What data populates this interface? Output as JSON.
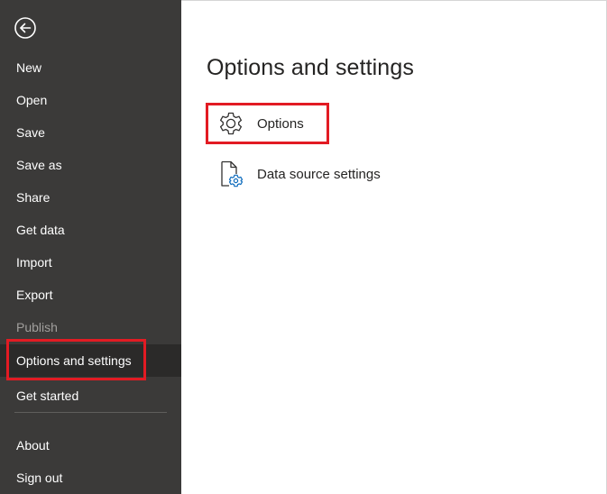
{
  "sidebar": {
    "back_icon": "back-arrow-icon",
    "items": [
      {
        "label": "New"
      },
      {
        "label": "Open"
      },
      {
        "label": "Save"
      },
      {
        "label": "Save as"
      },
      {
        "label": "Share"
      },
      {
        "label": "Get data"
      },
      {
        "label": "Import"
      },
      {
        "label": "Export"
      },
      {
        "label": "Publish",
        "disabled": true
      },
      {
        "label": "Options and settings",
        "selected": true
      },
      {
        "label": "Get started"
      },
      {
        "label": "About"
      },
      {
        "label": "Sign out"
      }
    ]
  },
  "main": {
    "title": "Options and settings",
    "options": [
      {
        "label": "Options",
        "icon": "gear-icon"
      },
      {
        "label": "Data source settings",
        "icon": "data-source-settings-icon"
      }
    ]
  },
  "colors": {
    "sidebar_bg": "#3b3a39",
    "selected_bg": "#2b2a29",
    "highlight": "#e21b23",
    "accent_blue": "#0f6cbd"
  }
}
